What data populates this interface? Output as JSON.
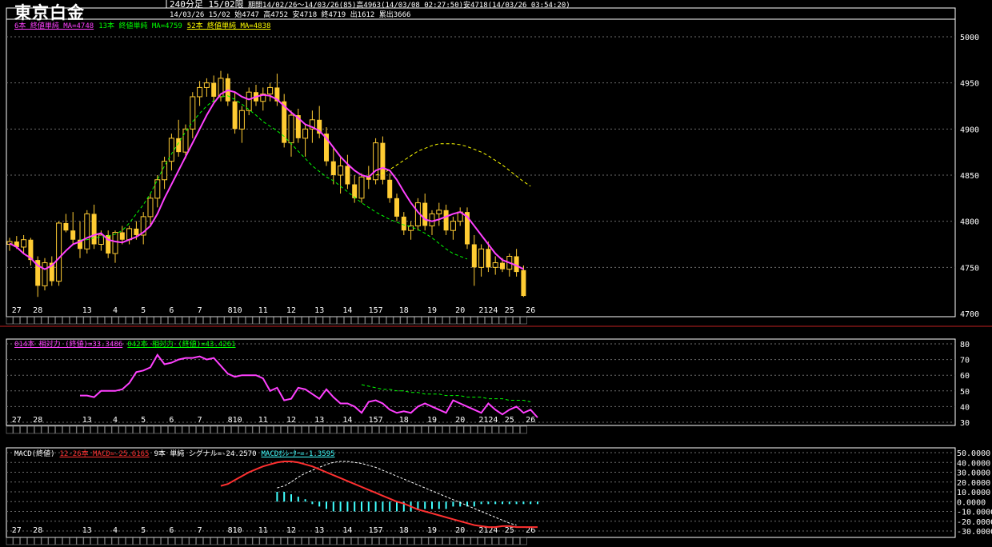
{
  "header": {
    "title": "東京白金",
    "line1_a": "240分足 15/02限",
    "line1_b": "期間14/02/26～14/03/26(85)高4963(14/03/08 02:27:50)安4718(14/03/26 03:54:20)",
    "line2": "14/03/26 15/02 始4747 高4752 安4718 終4719 出1612 累出3666"
  },
  "indicators": {
    "price_ma": [
      {
        "text": "6本 終値単純 MA=4748",
        "color": "#ff40ff"
      },
      {
        "text": "13本 終値単純 MA=4759",
        "color": "#00ff00"
      },
      {
        "text": "52本 終値単純 MA=4838",
        "color": "#ffff00"
      }
    ],
    "rsi": [
      {
        "text": "014本 相対力 (終値)=33.3486",
        "color": "#ff40ff"
      },
      {
        "text": "042本 相対力 (終値)=43.4261",
        "color": "#00ff00"
      }
    ],
    "macd": [
      {
        "text": "MACD(終値)",
        "color": "#ffffff"
      },
      {
        "text": "12-26本 MACD=-25.6165",
        "color": "#ff3030"
      },
      {
        "text": "9本 単純 シグナル=-24.2570",
        "color": "#ffffff"
      },
      {
        "text": "MACDｵｼﾚｰﾀｰ=-1.3595",
        "color": "#40ffff"
      }
    ]
  },
  "chart_data": {
    "type": "candlestick",
    "x_labels": [
      "27",
      "28",
      "13",
      "4",
      "5",
      "6",
      "7",
      "810",
      "11",
      "12",
      "13",
      "14",
      "157",
      "18",
      "19",
      "20",
      "2124",
      "25",
      "26"
    ],
    "price_axis": {
      "ticks": [
        5000,
        4950,
        4900,
        4850,
        4800,
        4750,
        4700
      ]
    },
    "rsi_axis": {
      "ticks": [
        80,
        70,
        60,
        50,
        40,
        30
      ]
    },
    "macd_axis": {
      "ticks": [
        "50.0000",
        "40.0000",
        "30.0000",
        "20.0000",
        "10.0000",
        "0.0000",
        "-10.0000",
        "-20.0000",
        "-30.0000"
      ]
    },
    "ohlc": [
      [
        4775,
        4782,
        4768,
        4778
      ],
      [
        4778,
        4784,
        4770,
        4772
      ],
      [
        4772,
        4785,
        4765,
        4780
      ],
      [
        4780,
        4782,
        4752,
        4758
      ],
      [
        4758,
        4762,
        4718,
        4730
      ],
      [
        4730,
        4760,
        4725,
        4755
      ],
      [
        4755,
        4762,
        4730,
        4735
      ],
      [
        4735,
        4800,
        4730,
        4798
      ],
      [
        4798,
        4808,
        4788,
        4790
      ],
      [
        4790,
        4810,
        4775,
        4780
      ],
      [
        4780,
        4800,
        4760,
        4770
      ],
      [
        4770,
        4812,
        4765,
        4808
      ],
      [
        4808,
        4818,
        4770,
        4775
      ],
      [
        4775,
        4790,
        4768,
        4785
      ],
      [
        4785,
        4790,
        4760,
        4765
      ],
      [
        4765,
        4790,
        4755,
        4788
      ],
      [
        4788,
        4795,
        4775,
        4780
      ],
      [
        4780,
        4795,
        4775,
        4792
      ],
      [
        4792,
        4800,
        4780,
        4785
      ],
      [
        4785,
        4810,
        4775,
        4805
      ],
      [
        4805,
        4830,
        4795,
        4825
      ],
      [
        4825,
        4850,
        4815,
        4845
      ],
      [
        4845,
        4870,
        4835,
        4865
      ],
      [
        4865,
        4895,
        4855,
        4890
      ],
      [
        4890,
        4910,
        4870,
        4875
      ],
      [
        4875,
        4905,
        4868,
        4900
      ],
      [
        4900,
        4940,
        4890,
        4935
      ],
      [
        4935,
        4952,
        4925,
        4945
      ],
      [
        4945,
        4955,
        4935,
        4950
      ],
      [
        4950,
        4958,
        4928,
        4935
      ],
      [
        4935,
        4963,
        4930,
        4955
      ],
      [
        4955,
        4960,
        4925,
        4930
      ],
      [
        4930,
        4940,
        4895,
        4900
      ],
      [
        4900,
        4925,
        4885,
        4920
      ],
      [
        4920,
        4945,
        4915,
        4940
      ],
      [
        4940,
        4948,
        4925,
        4930
      ],
      [
        4930,
        4945,
        4920,
        4938
      ],
      [
        4938,
        4950,
        4930,
        4945
      ],
      [
        4945,
        4960,
        4925,
        4930
      ],
      [
        4930,
        4938,
        4880,
        4885
      ],
      [
        4885,
        4920,
        4870,
        4915
      ],
      [
        4915,
        4922,
        4885,
        4890
      ],
      [
        4890,
        4905,
        4870,
        4900
      ],
      [
        4900,
        4920,
        4885,
        4910
      ],
      [
        4910,
        4925,
        4890,
        4895
      ],
      [
        4895,
        4902,
        4860,
        4865
      ],
      [
        4865,
        4880,
        4840,
        4850
      ],
      [
        4850,
        4870,
        4830,
        4860
      ],
      [
        4860,
        4872,
        4835,
        4840
      ],
      [
        4840,
        4850,
        4820,
        4825
      ],
      [
        4825,
        4852,
        4820,
        4848
      ],
      [
        4848,
        4860,
        4835,
        4845
      ],
      [
        4845,
        4890,
        4840,
        4885
      ],
      [
        4885,
        4892,
        4840,
        4845
      ],
      [
        4845,
        4852,
        4820,
        4825
      ],
      [
        4825,
        4830,
        4800,
        4805
      ],
      [
        4805,
        4810,
        4785,
        4790
      ],
      [
        4790,
        4800,
        4780,
        4795
      ],
      [
        4795,
        4825,
        4790,
        4820
      ],
      [
        4820,
        4830,
        4790,
        4795
      ],
      [
        4795,
        4812,
        4785,
        4808
      ],
      [
        4808,
        4820,
        4795,
        4812
      ],
      [
        4812,
        4818,
        4785,
        4790
      ],
      [
        4790,
        4805,
        4780,
        4800
      ],
      [
        4800,
        4815,
        4795,
        4810
      ],
      [
        4810,
        4815,
        4770,
        4775
      ],
      [
        4775,
        4785,
        4730,
        4750
      ],
      [
        4750,
        4775,
        4740,
        4770
      ],
      [
        4770,
        4778,
        4745,
        4750
      ],
      [
        4750,
        4762,
        4742,
        4755
      ],
      [
        4755,
        4760,
        4745,
        4748
      ],
      [
        4748,
        4765,
        4740,
        4762
      ],
      [
        4762,
        4770,
        4740,
        4745
      ],
      [
        4747,
        4752,
        4718,
        4719
      ]
    ],
    "ma6": [
      4776,
      4772,
      4765,
      4760,
      4752,
      4748,
      4752,
      4760,
      4768,
      4775,
      4778,
      4782,
      4785,
      4787,
      4780,
      4778,
      4777,
      4780,
      4783,
      4788,
      4795,
      4808,
      4825,
      4840,
      4855,
      4870,
      4885,
      4900,
      4915,
      4928,
      4938,
      4942,
      4940,
      4935,
      4932,
      4935,
      4937,
      4936,
      4932,
      4925,
      4918,
      4912,
      4905,
      4902,
      4898,
      4890,
      4880,
      4870,
      4862,
      4855,
      4850,
      4848,
      4855,
      4858,
      4855,
      4845,
      4832,
      4820,
      4810,
      4802,
      4800,
      4802,
      4805,
      4808,
      4810,
      4805,
      4795,
      4785,
      4775,
      4765,
      4758,
      4755,
      4752,
      4748
    ],
    "ma13_x": [
      10,
      73
    ],
    "ma13": [
      4780,
      4780,
      4782,
      4783,
      4784,
      4786,
      4790,
      4798,
      4808,
      4818,
      4830,
      4845,
      4860,
      4873,
      4885,
      4897,
      4908,
      4917,
      4925,
      4931,
      4935,
      4936,
      4932,
      4927,
      4921,
      4915,
      4908,
      4903,
      4898,
      4892,
      4884,
      4876,
      4868,
      4860,
      4854,
      4848,
      4844,
      4838,
      4832,
      4826,
      4820,
      4815,
      4810,
      4806,
      4802,
      4799,
      4796,
      4794,
      4791,
      4787,
      4782,
      4776,
      4770,
      4765,
      4762,
      4759
    ],
    "ma52_x": [
      52,
      73
    ],
    "ma52": [
      4850,
      4852,
      4856,
      4861,
      4866,
      4871,
      4876,
      4879,
      4882,
      4884,
      4884,
      4884,
      4883,
      4881,
      4878,
      4875,
      4871,
      4866,
      4861,
      4855,
      4849,
      4843,
      4838
    ],
    "rsi14": [
      47,
      47,
      46,
      50,
      50,
      50,
      51,
      55,
      62,
      63,
      65,
      73,
      67,
      68,
      70,
      71,
      71,
      72,
      70,
      71,
      66,
      61,
      59,
      60,
      60,
      60,
      58,
      50,
      52,
      44,
      45,
      52,
      51,
      48,
      45,
      51,
      46,
      42,
      42,
      40,
      36,
      43,
      44,
      42,
      38,
      36,
      37,
      36,
      40,
      42,
      40,
      38,
      36,
      44,
      42,
      40,
      38,
      36,
      42,
      38,
      35,
      38,
      40,
      36,
      38,
      33
    ],
    "rsi14_x": [
      10,
      75
    ],
    "rsi42": [
      54,
      53,
      52,
      51,
      51,
      50,
      50,
      49,
      49,
      48,
      48,
      48,
      47,
      47,
      47,
      46,
      46,
      46,
      45,
      45,
      45,
      44,
      44,
      44,
      43
    ],
    "rsi42_x": [
      50,
      74
    ],
    "macd": [
      16,
      18,
      22,
      26,
      30,
      33,
      36,
      38,
      40,
      41,
      41,
      40,
      38,
      36,
      33,
      30,
      27,
      24,
      21,
      18,
      15,
      12,
      9,
      6,
      3,
      0,
      -2,
      -5,
      -8,
      -10,
      -12,
      -14,
      -16,
      -18,
      -20,
      -22,
      -24,
      -25,
      -26,
      -26,
      -25,
      -25,
      -26,
      -26,
      -26,
      -26
    ],
    "macd_x": [
      30,
      75
    ],
    "signal": [
      14,
      16,
      20,
      25,
      29,
      32,
      35,
      38,
      40,
      41,
      41,
      40,
      39,
      37,
      35,
      32,
      29,
      26,
      23,
      20,
      17,
      14,
      11,
      8,
      5,
      2,
      -1,
      -4,
      -7,
      -10,
      -13,
      -16,
      -19,
      -22,
      -24
    ],
    "signal_x": [
      38,
      72
    ],
    "osc": [
      4,
      4,
      3,
      2,
      1,
      -1,
      -2,
      -3,
      -4,
      -4,
      -4,
      -4,
      -4,
      -4,
      -4,
      -4,
      -4,
      -4,
      -4,
      -4,
      -3,
      -3,
      -3,
      -3,
      -3,
      -2,
      -2,
      -2,
      -2,
      -1,
      -1,
      -1,
      -1,
      -1,
      -1,
      -1,
      -1,
      -1
    ],
    "osc_x": [
      38,
      75
    ],
    "colors": {
      "candle": "#ffcc33",
      "ma6": "#ff40ff",
      "ma13": "#00ff00",
      "ma52": "#ffff00",
      "macd": "#ff3030",
      "signal": "#ffffff",
      "osc": "#40ffff",
      "grid": "#6a6a6a"
    }
  }
}
